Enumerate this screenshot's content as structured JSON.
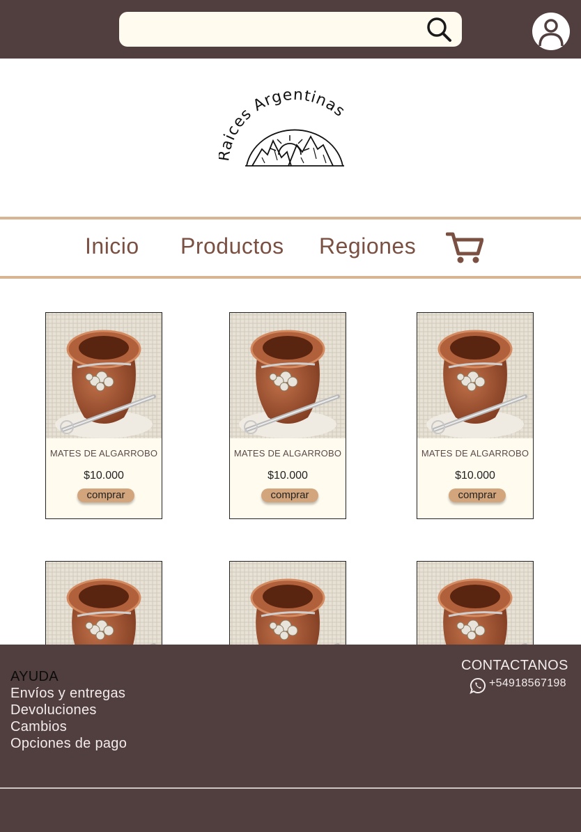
{
  "header": {
    "search_placeholder": "",
    "search_icon": "search-icon",
    "user_icon": "user-icon"
  },
  "logo": {
    "text": "Raices Argentinas"
  },
  "nav": {
    "items": [
      "Inicio",
      "Productos",
      "Regiones"
    ],
    "cart_icon": "cart-icon"
  },
  "products": [
    {
      "name": "MATES DE ALGARROBO",
      "price": "$10.000",
      "button": "comprar"
    },
    {
      "name": "MATES DE ALGARROBO",
      "price": "$10.000",
      "button": "comprar"
    },
    {
      "name": "MATES DE ALGARROBO",
      "price": "$10.000",
      "button": "comprar"
    },
    {
      "name": "",
      "price": "",
      "button": ""
    },
    {
      "name": "",
      "price": "",
      "button": ""
    },
    {
      "name": "",
      "price": "",
      "button": ""
    }
  ],
  "footer": {
    "help_title": "AYUDA",
    "help_links": [
      "Envíos y entregas",
      "Devoluciones",
      "Cambios",
      "Opciones de pago"
    ],
    "contact_title": "CONTACTANOS",
    "phone": "+54918567198",
    "whatsapp_icon": "whatsapp-icon"
  },
  "colors": {
    "topbar": "#513e3f",
    "accent": "#d7b593",
    "nav_text": "#7a5043",
    "card_bg": "#fffbef",
    "button": "#d3a57c"
  }
}
